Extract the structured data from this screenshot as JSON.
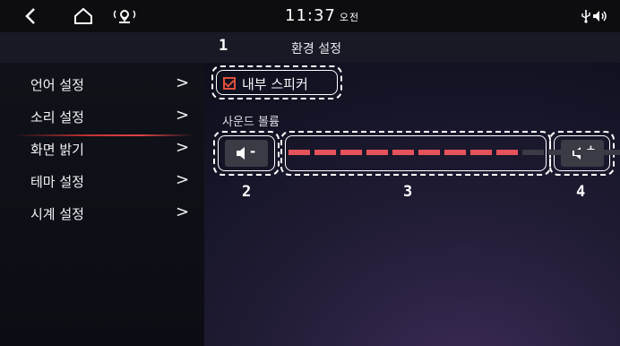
{
  "status_bar": {
    "back_icon": "chevron-left-icon",
    "home_icon": "home-icon",
    "location_icon": "location-signal-icon",
    "time": "11:37",
    "ampm": "오전",
    "usb_icon": "usb-icon",
    "volume_icon": "volume-icon"
  },
  "header": {
    "title": "환경 설정"
  },
  "sidebar": {
    "items": [
      {
        "label": "언어 설정",
        "chevron": ">"
      },
      {
        "label": "소리 설정",
        "chevron": ">",
        "active": true
      },
      {
        "label": "화면 밝기",
        "chevron": ">"
      },
      {
        "label": "테마 설정",
        "chevron": ">"
      },
      {
        "label": "시계 설정",
        "chevron": ">"
      }
    ]
  },
  "main": {
    "internal_speaker": {
      "label": "내부 스피커",
      "checked": true
    },
    "volume": {
      "label": "사운드 볼륨",
      "minus_label": "-",
      "plus_label": "+",
      "level": 9,
      "segments": 15
    }
  },
  "annotations": [
    "1",
    "2",
    "3",
    "4"
  ],
  "colors": {
    "accent": "#e0503c",
    "active_segment": "#e5535a",
    "inactive_segment": "#3a3b44"
  }
}
